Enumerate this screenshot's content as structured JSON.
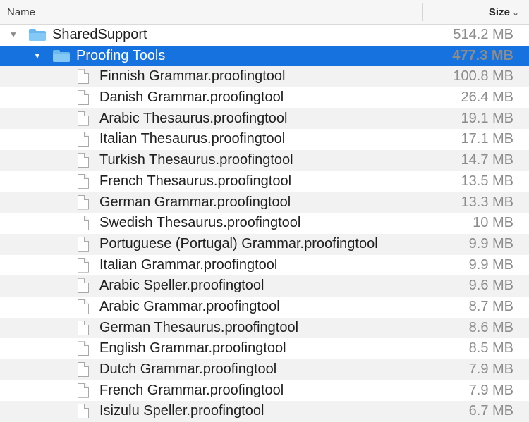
{
  "header": {
    "name_label": "Name",
    "size_label": "Size",
    "sort_glyph": "⌄"
  },
  "colors": {
    "selection": "#1672df",
    "folder": "#6cb8ee",
    "alt_row": "#f2f2f2"
  },
  "folder_root": {
    "name": "SharedSupport",
    "size": "514.2 MB",
    "disclosure": "▼",
    "icon": "folder-icon"
  },
  "folder_selected": {
    "name": "Proofing Tools",
    "size": "477.3 MB",
    "disclosure": "▼",
    "icon": "folder-icon"
  },
  "files": [
    {
      "name": "Finnish Grammar.proofingtool",
      "size": "100.8 MB"
    },
    {
      "name": "Danish Grammar.proofingtool",
      "size": "26.4 MB"
    },
    {
      "name": "Arabic Thesaurus.proofingtool",
      "size": "19.1 MB"
    },
    {
      "name": "Italian Thesaurus.proofingtool",
      "size": "17.1 MB"
    },
    {
      "name": "Turkish Thesaurus.proofingtool",
      "size": "14.7 MB"
    },
    {
      "name": "French Thesaurus.proofingtool",
      "size": "13.5 MB"
    },
    {
      "name": "German Grammar.proofingtool",
      "size": "13.3 MB"
    },
    {
      "name": "Swedish Thesaurus.proofingtool",
      "size": "10 MB"
    },
    {
      "name": "Portuguese (Portugal) Grammar.proofingtool",
      "size": "9.9 MB"
    },
    {
      "name": "Italian Grammar.proofingtool",
      "size": "9.9 MB"
    },
    {
      "name": "Arabic Speller.proofingtool",
      "size": "9.6 MB"
    },
    {
      "name": "Arabic Grammar.proofingtool",
      "size": "8.7 MB"
    },
    {
      "name": "German Thesaurus.proofingtool",
      "size": "8.6 MB"
    },
    {
      "name": "English Grammar.proofingtool",
      "size": "8.5 MB"
    },
    {
      "name": "Dutch Grammar.proofingtool",
      "size": "7.9 MB"
    },
    {
      "name": "French Grammar.proofingtool",
      "size": "7.9 MB"
    },
    {
      "name": "Isizulu Speller.proofingtool",
      "size": "6.7 MB"
    }
  ]
}
